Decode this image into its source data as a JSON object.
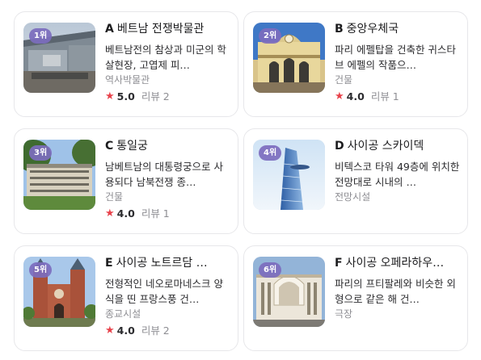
{
  "cards": [
    {
      "rank": "1위",
      "letter": "A",
      "name": "베트남 전쟁박물관",
      "description": "베트남전의 참상과 미군의 학살현장, 고엽제 피…",
      "category": "역사박물관",
      "rating": "5.0",
      "reviews": "리뷰 2",
      "image_icon": "war-museum-photo"
    },
    {
      "rank": "2위",
      "letter": "B",
      "name": "중앙우체국",
      "description": "파리 에펠탑을 건축한 귀스타브 에펠의 작품으…",
      "category": "건물",
      "rating": "4.0",
      "reviews": "리뷰 1",
      "image_icon": "post-office-photo"
    },
    {
      "rank": "3위",
      "letter": "C",
      "name": "통일궁",
      "description": "남베트남의 대통령궁으로 사용되다 남북전쟁 종…",
      "category": "건물",
      "rating": "4.0",
      "reviews": "리뷰 1",
      "image_icon": "palace-photo"
    },
    {
      "rank": "4위",
      "letter": "D",
      "name": "사이공 스카이덱",
      "description": "비텍스코 타워 49층에 위치한 전망대로 시내의 …",
      "category": "전망시설",
      "rating": null,
      "reviews": null,
      "image_icon": "skyscraper-photo"
    },
    {
      "rank": "5위",
      "letter": "E",
      "name": "사이공 노트르담 …",
      "description": "전형적인 네오로마네스크 양식을 띤 프랑스풍 건…",
      "category": "종교시설",
      "rating": "4.0",
      "reviews": "리뷰 2",
      "image_icon": "cathedral-photo"
    },
    {
      "rank": "6위",
      "letter": "F",
      "name": "사이공 오페라하우…",
      "description": "파리의 프티팔레와 비슷한 외형으로 같은 해 건…",
      "category": "극장",
      "rating": null,
      "reviews": null,
      "image_icon": "opera-house-photo"
    }
  ],
  "colors": {
    "rank_badge": "#7c6cbe",
    "star": "#e8424b"
  }
}
